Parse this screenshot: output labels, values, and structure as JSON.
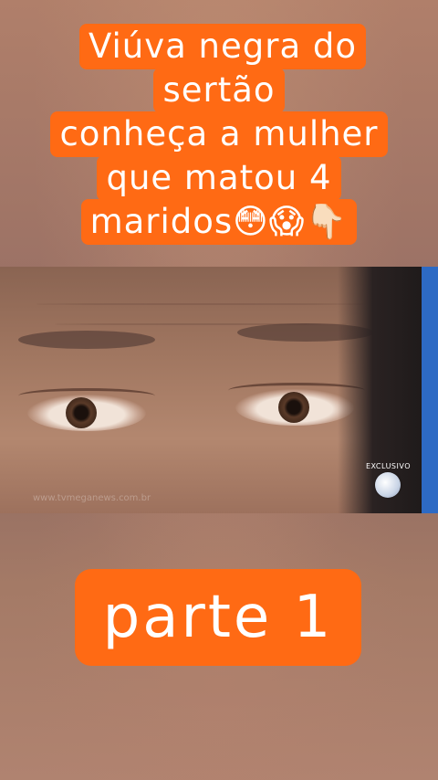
{
  "headline": {
    "lines": [
      "Viúva negra do",
      "sertão",
      "conheça a mulher",
      "que matou 4",
      "maridos😳😱👇🏻"
    ]
  },
  "video": {
    "watermark": "www.tvmeganews.com.br",
    "logo_label": "EXCLUSIVO"
  },
  "part_label": "parte 1"
}
